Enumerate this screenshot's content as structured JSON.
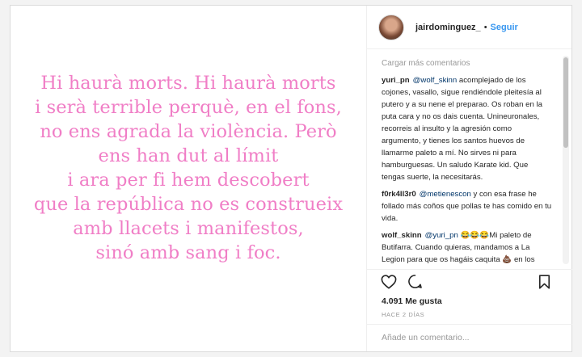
{
  "post": {
    "quote_lines": [
      "Hi haurà morts. Hi haurà morts",
      "i serà terrible perquè, en el fons,",
      "no ens agrada la violència. Però",
      "ens han dut al límit",
      "i ara per fi hem descobert",
      "que la república no es construeix",
      "amb llacets i manifestos,",
      "sinó amb sang i foc."
    ],
    "quote_color": "#f07ec6"
  },
  "header": {
    "username": "jairdominguez_",
    "separator": "•",
    "follow_label": "Seguir"
  },
  "comments": {
    "load_more": "Cargar más comentarios",
    "items": [
      {
        "author": "yuri_pn",
        "mention": "@wolf_skinn",
        "text": "acomplejado de los cojones, vasallo, sigue rendiéndole pleitesía al putero y a su nene el preparao. Os roban en la puta cara y no os dais cuenta. Unineuronales, recorreis al insulto y la agresión como argumento, y tienes los santos huevos de llamarme paleto a mí. No sirves ni para hamburguesas. Un saludo Karate kid. Que tengas suerte, la necesitarás."
      },
      {
        "author": "f0rk4ll3r0",
        "mention": "@metienescon",
        "text": "y con esa frase he follado más coños que pollas te has comido en tu vida."
      },
      {
        "author": "wolf_skinn",
        "mention": "@yuri_pn",
        "text": "😂😂😂Mi paleto de Butifarra. Cuando quieras, mandamos a La Legion para que os hagáis caquita 💩 en los pantalones. Hoy abro otra botella de Champán 🍾. Baja a por tu ración de"
      }
    ]
  },
  "actions": {
    "like_icon": "heart-outline-icon",
    "comment_icon": "speech-bubble-icon",
    "save_icon": "bookmark-icon"
  },
  "stats": {
    "likes": "4.091 Me gusta",
    "time_ago": "HACE 2 DÍAS"
  },
  "add_comment": {
    "placeholder": "Añade un comentario..."
  },
  "colors": {
    "link_blue": "#3897f0",
    "mention_blue": "#003569",
    "muted_gray": "#999999"
  }
}
